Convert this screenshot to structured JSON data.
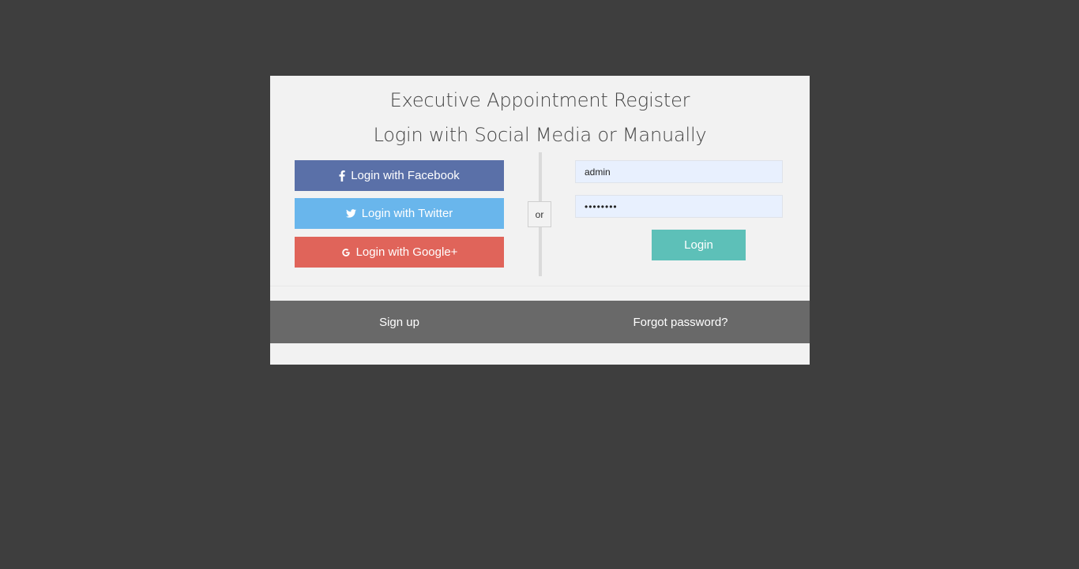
{
  "header": {
    "title": "Executive Appointment Register",
    "subtitle": "Login with Social Media or Manually"
  },
  "social": {
    "facebook_label": "Login with Facebook",
    "twitter_label": "Login with Twitter",
    "google_label": "Login with Google+"
  },
  "divider": {
    "or_label": "or"
  },
  "form": {
    "username_value": "admin",
    "password_value": "••••••••",
    "login_label": "Login"
  },
  "footer": {
    "signup_label": "Sign up",
    "forgot_label": "Forgot password?"
  },
  "colors": {
    "background": "#3e3e3e",
    "card": "#f2f2f2",
    "facebook": "#5a70a8",
    "twitter": "#69b6ec",
    "google": "#e0645a",
    "login": "#5dc0b8",
    "footer": "#696969",
    "input_fill": "#e8f0fe"
  },
  "icons": {
    "facebook": "facebook-icon",
    "twitter": "twitter-icon",
    "google": "google-icon"
  }
}
